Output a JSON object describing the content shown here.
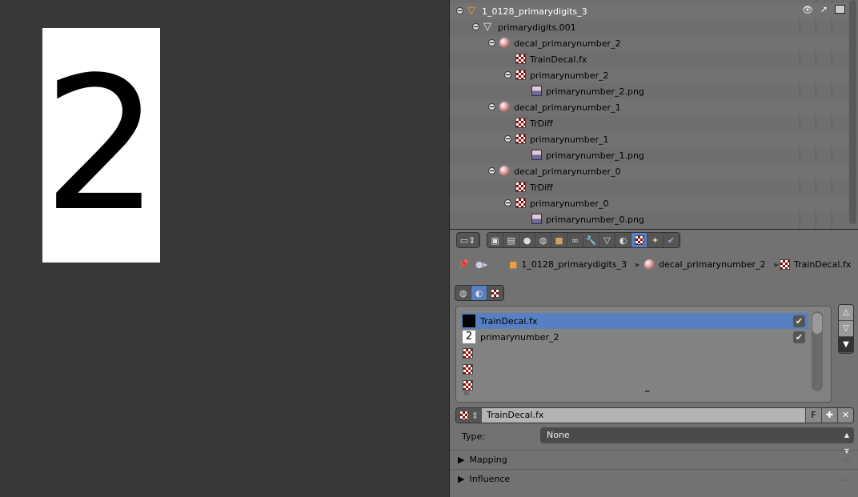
{
  "viewer": {
    "image_text": "2"
  },
  "outliner": {
    "rows": [
      {
        "label": "1_0128_primarydigits_3",
        "icon": "mesh-object-icon"
      },
      {
        "label": "primarydigits.001",
        "icon": "mesh-data-icon"
      },
      {
        "label": "decal_primarynumber_2",
        "icon": "material-icon"
      },
      {
        "label": "TrainDecal.fx",
        "icon": "texture-icon"
      },
      {
        "label": "primarynumber_2",
        "icon": "texture-icon"
      },
      {
        "label": "primarynumber_2.png",
        "icon": "image-icon"
      },
      {
        "label": "decal_primarynumber_1",
        "icon": "material-icon"
      },
      {
        "label": "TrDiff",
        "icon": "texture-icon"
      },
      {
        "label": "primarynumber_1",
        "icon": "texture-icon"
      },
      {
        "label": "primarynumber_1.png",
        "icon": "image-icon"
      },
      {
        "label": "decal_primarynumber_0",
        "icon": "material-icon"
      },
      {
        "label": "TrDiff",
        "icon": "texture-icon"
      },
      {
        "label": "primarynumber_0",
        "icon": "texture-icon"
      },
      {
        "label": "primarynumber_0.png",
        "icon": "image-icon"
      }
    ]
  },
  "breadcrumb": {
    "object": "1_0128_primarydigits_3",
    "material": "decal_primarynumber_2",
    "texture": "TrainDecal.fx"
  },
  "texture_slots": [
    {
      "label": "TrainDecal.fx",
      "checked": true,
      "selected": true
    },
    {
      "label": "primarynumber_2",
      "checked": true,
      "selected": false
    },
    {
      "label": ""
    },
    {
      "label": ""
    },
    {
      "label": ""
    }
  ],
  "id_block": {
    "name": "TrainDecal.fx",
    "fake_user": "F"
  },
  "type": {
    "label": "Type:",
    "value": "None"
  },
  "panels": [
    {
      "label": "Mapping"
    },
    {
      "label": "Influence"
    }
  ],
  "colors": {
    "selection": "#5680c2",
    "background": "#727272"
  }
}
